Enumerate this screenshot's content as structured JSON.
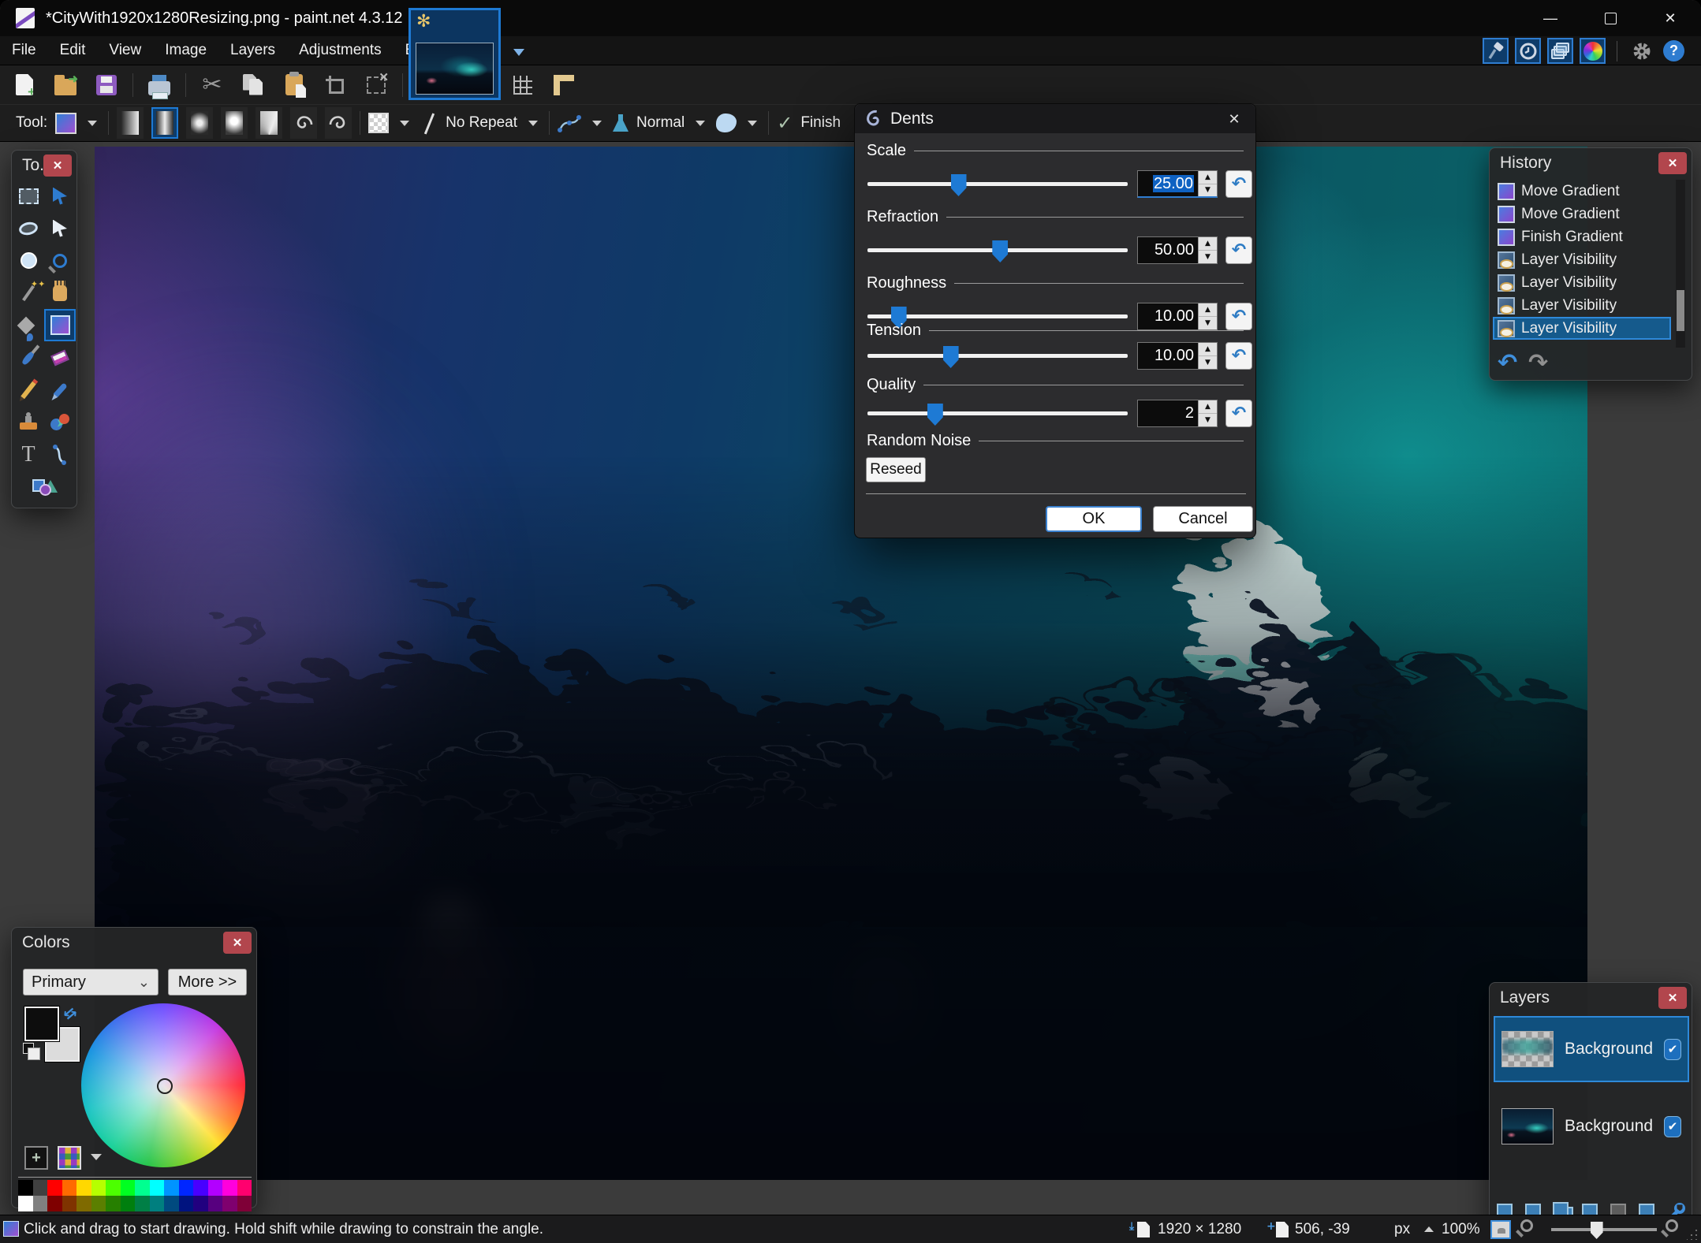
{
  "accent": {
    "primary": "#2e7cd0",
    "selection": "#155a8c",
    "close_red": "#b2464d"
  },
  "window": {
    "title": "*CityWith1920x1280Resizing.png - paint.net 4.3.12"
  },
  "menu": {
    "items": [
      "File",
      "Edit",
      "View",
      "Image",
      "Layers",
      "Adjustments",
      "Effects"
    ]
  },
  "tool_options": {
    "tool_label": "Tool:",
    "repeat_mode": "No Repeat",
    "blend_mode": "Normal",
    "finish_label": "Finish"
  },
  "dialog": {
    "title": "Dents",
    "params": [
      {
        "label": "Scale",
        "value": "25.00",
        "pct": 35,
        "selected": true
      },
      {
        "label": "Refraction",
        "value": "50.00",
        "pct": 51
      },
      {
        "label": "Roughness",
        "value": "10.00",
        "pct": 12
      },
      {
        "label": "Tension",
        "value": "10.00",
        "pct": 32
      },
      {
        "label": "Quality",
        "value": "2",
        "pct": 26
      }
    ],
    "random_noise_label": "Random Noise",
    "reseed_label": "Reseed",
    "ok_label": "OK",
    "cancel_label": "Cancel"
  },
  "history": {
    "title": "History",
    "items": [
      {
        "label": "Move Gradient",
        "icon": "gradient"
      },
      {
        "label": "Move Gradient",
        "icon": "gradient"
      },
      {
        "label": "Finish Gradient",
        "icon": "gradient"
      },
      {
        "label": "Layer Visibility",
        "icon": "eye"
      },
      {
        "label": "Layer Visibility",
        "icon": "eye"
      },
      {
        "label": "Layer Visibility",
        "icon": "eye"
      },
      {
        "label": "Layer Visibility",
        "icon": "eye"
      }
    ],
    "selected_index": 6
  },
  "tools_panel": {
    "title": "To..."
  },
  "colors_panel": {
    "title": "Colors",
    "mode": "Primary",
    "more_label": "More >>",
    "palette": [
      [
        "#000000",
        "#404040",
        "#FF0000",
        "#FF6A00",
        "#FFD800",
        "#B6FF00",
        "#4CFF00",
        "#00FF21",
        "#00FF90",
        "#00FFFF",
        "#0094FF",
        "#0026FF",
        "#4800FF",
        "#B200FF",
        "#FF00DC",
        "#FF006E"
      ],
      [
        "#FFFFFF",
        "#808080",
        "#7F0000",
        "#7F3300",
        "#7F6A00",
        "#5B7F00",
        "#267F00",
        "#007F0E",
        "#007F46",
        "#007F7F",
        "#004A7F",
        "#00137F",
        "#21007F",
        "#57007F",
        "#7F006E",
        "#7F0037"
      ]
    ]
  },
  "layers_panel": {
    "title": "Layers",
    "layers": [
      {
        "name": "Background",
        "checked": true,
        "thumb": "checker",
        "selected": true
      },
      {
        "name": "Background",
        "checked": true,
        "thumb": "city",
        "selected": false
      }
    ]
  },
  "status_bar": {
    "message": "Click and drag to start drawing. Hold shift while drawing to constrain the angle.",
    "canvas_size": "1920 × 1280",
    "cursor_pos": "506, -39",
    "unit": "px",
    "zoom_level": "100%",
    "zoom_slider_pct": 43
  }
}
